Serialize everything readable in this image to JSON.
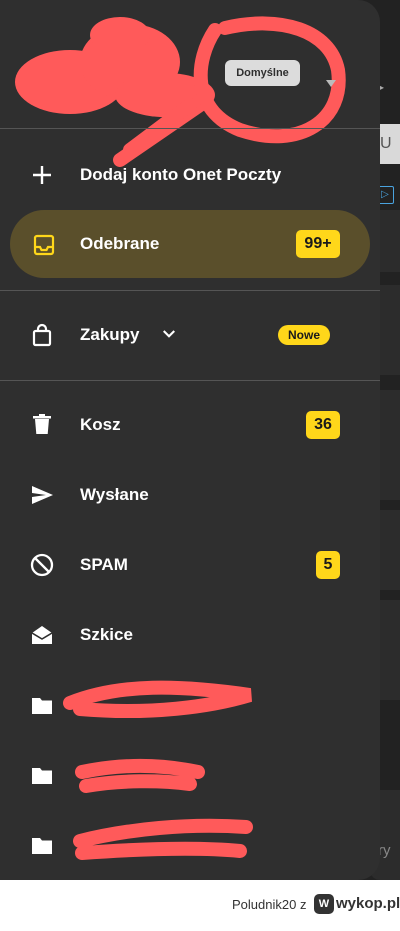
{
  "colors": {
    "drawer_bg": "#2f2f2f",
    "selected_bg": "#5a4f2b",
    "badge_yellow": "#ffd71a",
    "redaction": "#ff5a5a"
  },
  "header": {
    "default_chip": "Domyślne",
    "avatar_redacted": true
  },
  "add_account": {
    "label": "Dodaj konto Onet Poczty",
    "icon": "plus-icon"
  },
  "inbox": {
    "label": "Odebrane",
    "count": "99+",
    "icon": "inbox-icon"
  },
  "shopping": {
    "label": "Zakupy",
    "badge": "Nowe",
    "icon": "shopping-bag-icon"
  },
  "folders": [
    {
      "label": "Kosz",
      "count": "36",
      "icon": "trash-icon"
    },
    {
      "label": "Wysłane",
      "count": "",
      "icon": "send-icon"
    },
    {
      "label": "SPAM",
      "count": "5",
      "icon": "block-icon"
    },
    {
      "label": "Szkice",
      "count": "",
      "icon": "draft-icon"
    }
  ],
  "custom_folders_redacted": 3,
  "background": {
    "input_text": "U",
    "side_text": "ry"
  },
  "footer": {
    "user": "Poludnik20",
    "z": "z",
    "site": "wykop.pl",
    "logo": "W"
  }
}
